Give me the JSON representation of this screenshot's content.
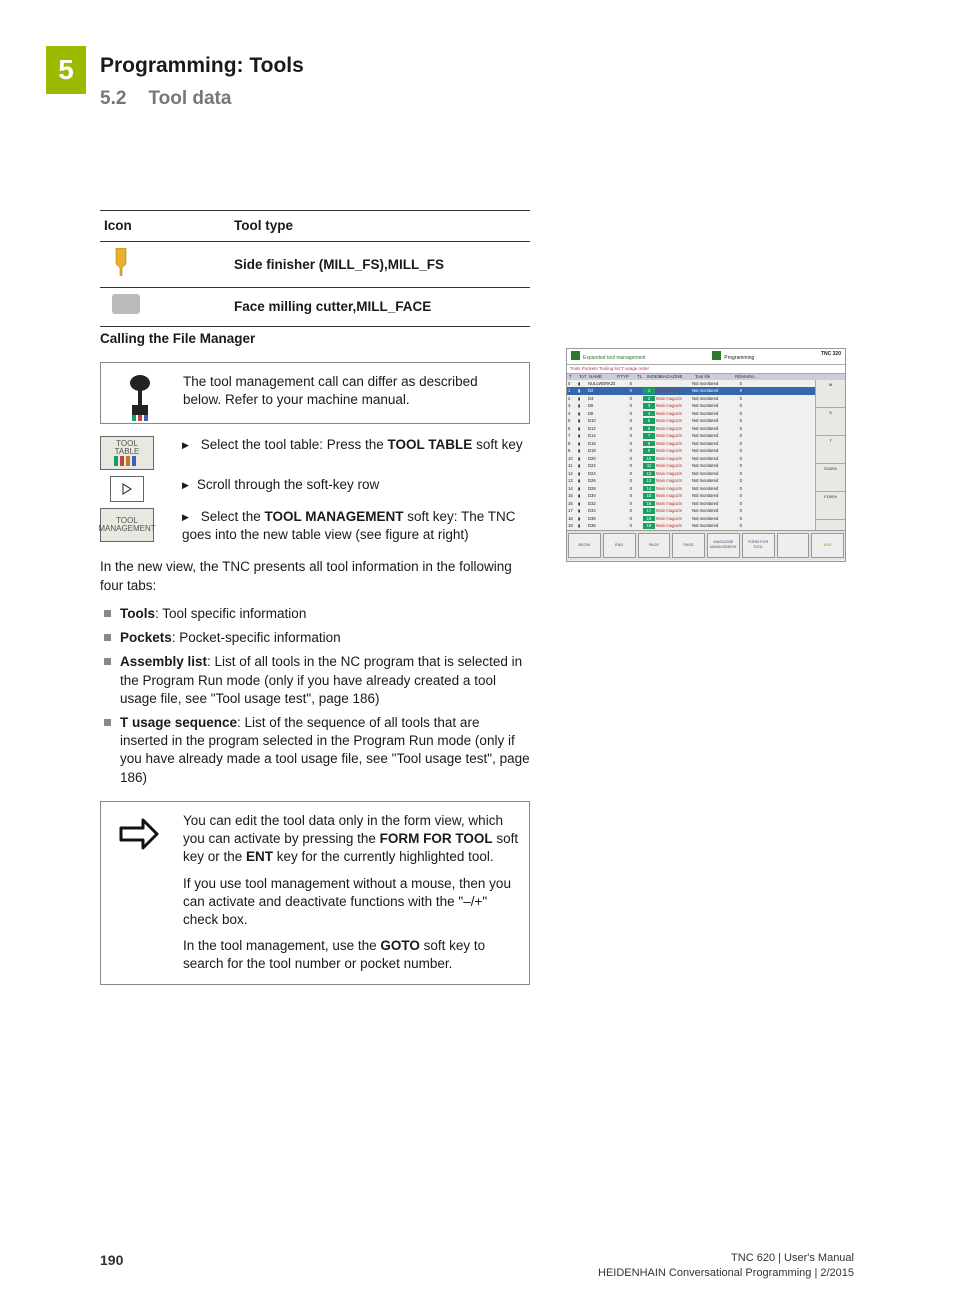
{
  "chapter_tab": "5",
  "heading1": "Programming: Tools",
  "heading2_num": "5.2",
  "heading2_text": "Tool data",
  "icon_table": {
    "header_icon": "Icon",
    "header_type": "Tool type",
    "row1": "Side finisher (MILL_FS),MILL_FS",
    "row2": "Face milling cutter,MILL_FACE"
  },
  "subheading": "Calling the File Manager",
  "info1": "The tool management call can differ as described below. Refer to your machine manual.",
  "softkey1_l1": "TOOL",
  "softkey1_l2": "TABLE",
  "step1_pre": "Select the tool table: Press the ",
  "step1_bold": "TOOL TABLE",
  "step1_post": " soft key",
  "step2": "Scroll through the soft-key row",
  "softkey3_l1": "TOOL",
  "softkey3_l2": "MANAGEMENT",
  "step3_pre": "Select the ",
  "step3_bold": "TOOL MANAGEMENT",
  "step3_post": " soft key: The TNC goes into the new table view (see figure at right)",
  "para_after_steps": "In the new view, the TNC presents all tool information in the following four tabs:",
  "bullets": {
    "b1_bold": "Tools",
    "b1_text": ": Tool specific information",
    "b2_bold": "Pockets",
    "b2_text": ": Pocket-specific information",
    "b3_bold": "Assembly list",
    "b3_text": ": List of all tools in the NC program that is selected in the Program Run mode (only if you have already created a tool usage file, see \"Tool usage test\", page 186)",
    "b4_bold": "T usage sequence",
    "b4_text": ": List of the sequence of all tools that are inserted in the program selected in the Program Run mode (only if you have already made a tool usage file, see \"Tool usage test\", page 186)"
  },
  "note_box": {
    "p1_pre": "You can edit the tool data only in the form view, which you can activate by pressing the ",
    "p1_b1": "FORM FOR TOOL",
    "p1_mid": " soft key or the ",
    "p1_b2": "ENT",
    "p1_post": " key for the currently highlighted tool.",
    "p2": "If you use tool management without a mouse, then you can activate and deactivate functions with the \"–/+\" check box.",
    "p3_pre": "In the tool management, use the ",
    "p3_b": "GOTO",
    "p3_post": " soft key to search for the tool number or pocket number."
  },
  "screenshot": {
    "title": "Expanded tool management",
    "mode": "Programming",
    "model": "TNC 320",
    "tabs": "Tools Pockets Tooling list T usage order",
    "cols": {
      "t": "T",
      "tot": "ToT",
      "name": "NAME",
      "ptyp": "PTYP",
      "tl": "TL",
      "index": "INDEX",
      "mag": "MAGAZINE",
      "life": "Tool life",
      "remain": "REMAINI..."
    },
    "rows": [
      {
        "t": "0",
        "name": "NULLWERKZEUG",
        "ptyp": "0",
        "idx": "",
        "mag": "",
        "life": "Not monitored",
        "rem": "0"
      },
      {
        "t": "1",
        "name": "D2",
        "ptyp": "0",
        "idx": "1",
        "mag": "Main magazin",
        "life": "Not monitored",
        "rem": "0",
        "sel": true
      },
      {
        "t": "2",
        "name": "D4",
        "ptyp": "0",
        "idx": "2",
        "mag": "Main magazin",
        "life": "Not monitored",
        "rem": "0"
      },
      {
        "t": "3",
        "name": "D6",
        "ptyp": "0",
        "idx": "3",
        "mag": "Main magazin",
        "life": "Not monitored",
        "rem": "0"
      },
      {
        "t": "4",
        "name": "D8",
        "ptyp": "0",
        "idx": "4",
        "mag": "Main magazin",
        "life": "Not monitored",
        "rem": "0"
      },
      {
        "t": "5",
        "name": "D10",
        "ptyp": "0",
        "idx": "5",
        "mag": "Main magazin",
        "life": "Not monitored",
        "rem": "0"
      },
      {
        "t": "6",
        "name": "D12",
        "ptyp": "0",
        "idx": "6",
        "mag": "Main magazin",
        "life": "Not monitored",
        "rem": "0"
      },
      {
        "t": "7",
        "name": "D14",
        "ptyp": "0",
        "idx": "7",
        "mag": "Main magazin",
        "life": "Not monitored",
        "rem": "0"
      },
      {
        "t": "8",
        "name": "D16",
        "ptyp": "0",
        "idx": "8",
        "mag": "Main magazin",
        "life": "Not monitored",
        "rem": "0"
      },
      {
        "t": "9",
        "name": "D18",
        "ptyp": "0",
        "idx": "9",
        "mag": "Main magazin",
        "life": "Not monitored",
        "rem": "0"
      },
      {
        "t": "10",
        "name": "D20",
        "ptyp": "0",
        "idx": "10",
        "mag": "Main magazin",
        "life": "Not monitored",
        "rem": "0"
      },
      {
        "t": "11",
        "name": "D22",
        "ptyp": "0",
        "idx": "11",
        "mag": "Main magazin",
        "life": "Not monitored",
        "rem": "0"
      },
      {
        "t": "12",
        "name": "D24",
        "ptyp": "0",
        "idx": "12",
        "mag": "Main magazin",
        "life": "Not monitored",
        "rem": "0"
      },
      {
        "t": "13",
        "name": "D26",
        "ptyp": "0",
        "idx": "13",
        "mag": "Main magazin",
        "life": "Not monitored",
        "rem": "0"
      },
      {
        "t": "14",
        "name": "D28",
        "ptyp": "0",
        "idx": "14",
        "mag": "Main magazin",
        "life": "Not monitored",
        "rem": "0"
      },
      {
        "t": "15",
        "name": "D30",
        "ptyp": "0",
        "idx": "15",
        "mag": "Main magazin",
        "life": "Not monitored",
        "rem": "0"
      },
      {
        "t": "16",
        "name": "D32",
        "ptyp": "0",
        "idx": "16",
        "mag": "Main magazin",
        "life": "Not monitored",
        "rem": "0"
      },
      {
        "t": "17",
        "name": "D34",
        "ptyp": "0",
        "idx": "17",
        "mag": "Main magazin",
        "life": "Not monitored",
        "rem": "0"
      },
      {
        "t": "18",
        "name": "D36",
        "ptyp": "0",
        "idx": "18",
        "mag": "Main magazin",
        "life": "Not monitored",
        "rem": "0"
      },
      {
        "t": "19",
        "name": "D38",
        "ptyp": "0",
        "idx": "19",
        "mag": "Main magazin",
        "life": "Not monitored",
        "rem": "0"
      }
    ],
    "side_labels": {
      "s": "S100%",
      "f": "F100%"
    },
    "softkeys": [
      "BEGIN",
      "END",
      "PAGE",
      "PAGE",
      "MAGAZINE MANAGEMENT",
      "FORM FOR TOOL",
      "",
      "END"
    ]
  },
  "footer": {
    "page": "190",
    "line1": "TNC 620 | User's Manual",
    "line2": "HEIDENHAIN Conversational Programming | 2/2015"
  }
}
